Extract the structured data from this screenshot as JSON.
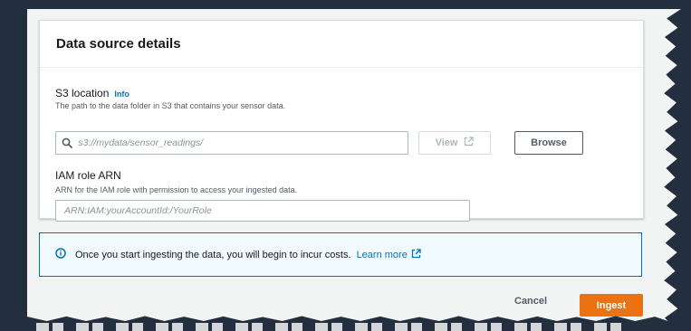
{
  "card": {
    "title": "Data source details"
  },
  "s3_location": {
    "label": "S3 location",
    "info_link": "Info",
    "description": "The path to the data folder in S3 that contains your sensor data.",
    "placeholder": "s3://mydata/sensor_readings/",
    "view_label": "View",
    "browse_label": "Browse"
  },
  "iam_role": {
    "label": "IAM role ARN",
    "description": "ARN for the IAM role with permission to access your ingested data.",
    "placeholder": "ARN:IAM:yourAccountId:/YourRole"
  },
  "alert": {
    "text": "Once you start ingesting the data, you will begin to incur costs.",
    "link": "Learn more"
  },
  "actions": {
    "cancel_label": "Cancel",
    "ingest_label": "Ingest"
  },
  "colors": {
    "primary": "#ec7211",
    "link": "#0073bb",
    "background": "#232f3e"
  }
}
